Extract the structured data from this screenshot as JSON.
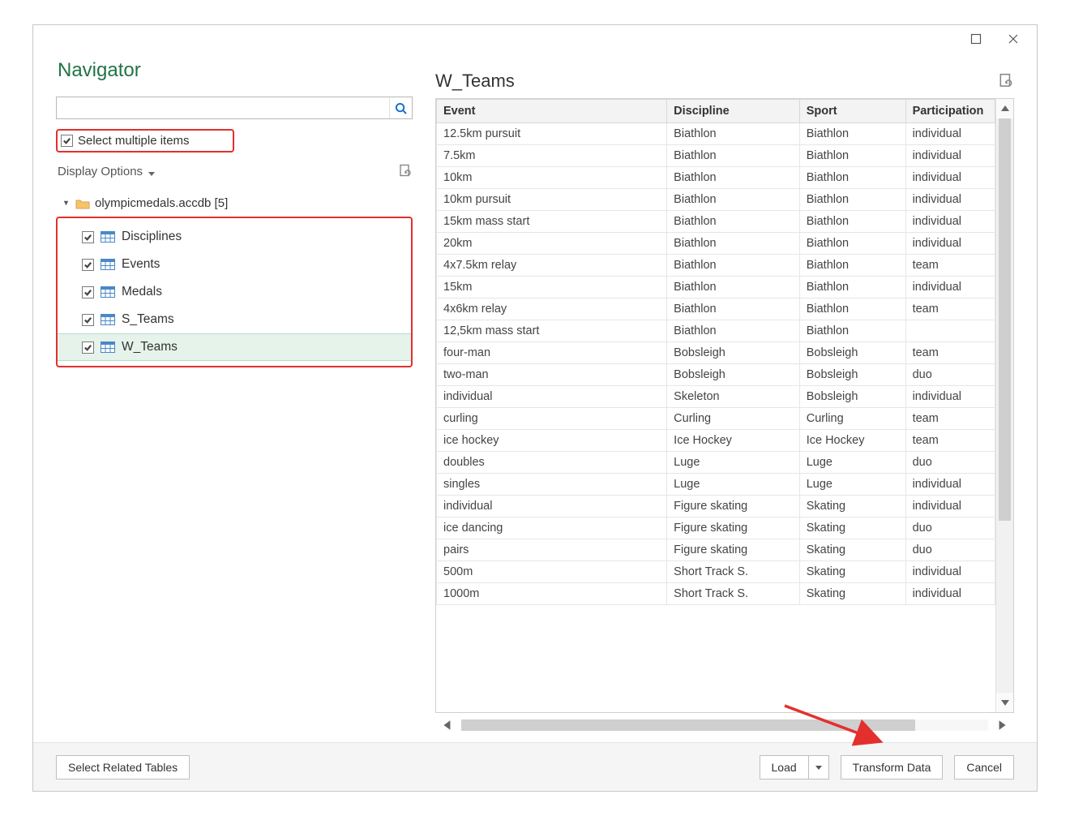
{
  "title": "Navigator",
  "search": {
    "placeholder": ""
  },
  "multi_select_label": "Select multiple items",
  "display_options_label": "Display Options",
  "tree": {
    "folder_label": "olympicmedals.accdb [5]",
    "items": [
      {
        "label": "Disciplines",
        "checked": true
      },
      {
        "label": "Events",
        "checked": true
      },
      {
        "label": "Medals",
        "checked": true
      },
      {
        "label": "S_Teams",
        "checked": true
      },
      {
        "label": "W_Teams",
        "checked": true,
        "selected": true
      }
    ]
  },
  "preview": {
    "title": "W_Teams",
    "columns": [
      "Event",
      "Discipline",
      "Sport",
      "Participation"
    ],
    "rows": [
      [
        "12.5km pursuit",
        "Biathlon",
        "Biathlon",
        "individual"
      ],
      [
        "7.5km",
        "Biathlon",
        "Biathlon",
        "individual"
      ],
      [
        "10km",
        "Biathlon",
        "Biathlon",
        "individual"
      ],
      [
        "10km pursuit",
        "Biathlon",
        "Biathlon",
        "individual"
      ],
      [
        "15km mass start",
        "Biathlon",
        "Biathlon",
        "individual"
      ],
      [
        "20km",
        "Biathlon",
        "Biathlon",
        "individual"
      ],
      [
        "4x7.5km relay",
        "Biathlon",
        "Biathlon",
        "team"
      ],
      [
        "15km",
        "Biathlon",
        "Biathlon",
        "individual"
      ],
      [
        "4x6km relay",
        "Biathlon",
        "Biathlon",
        "team"
      ],
      [
        "12,5km mass start",
        "Biathlon",
        "Biathlon",
        ""
      ],
      [
        "four-man",
        "Bobsleigh",
        "Bobsleigh",
        "team"
      ],
      [
        "two-man",
        "Bobsleigh",
        "Bobsleigh",
        "duo"
      ],
      [
        "individual",
        "Skeleton",
        "Bobsleigh",
        "individual"
      ],
      [
        "curling",
        "Curling",
        "Curling",
        "team"
      ],
      [
        "ice hockey",
        "Ice Hockey",
        "Ice Hockey",
        "team"
      ],
      [
        "doubles",
        "Luge",
        "Luge",
        "duo"
      ],
      [
        "singles",
        "Luge",
        "Luge",
        "individual"
      ],
      [
        "individual",
        "Figure skating",
        "Skating",
        "individual"
      ],
      [
        "ice dancing",
        "Figure skating",
        "Skating",
        "duo"
      ],
      [
        "pairs",
        "Figure skating",
        "Skating",
        "duo"
      ],
      [
        "500m",
        "Short Track S.",
        "Skating",
        "individual"
      ],
      [
        "1000m",
        "Short Track S.",
        "Skating",
        "individual"
      ]
    ]
  },
  "buttons": {
    "select_related": "Select Related Tables",
    "load": "Load",
    "transform": "Transform Data",
    "cancel": "Cancel"
  }
}
